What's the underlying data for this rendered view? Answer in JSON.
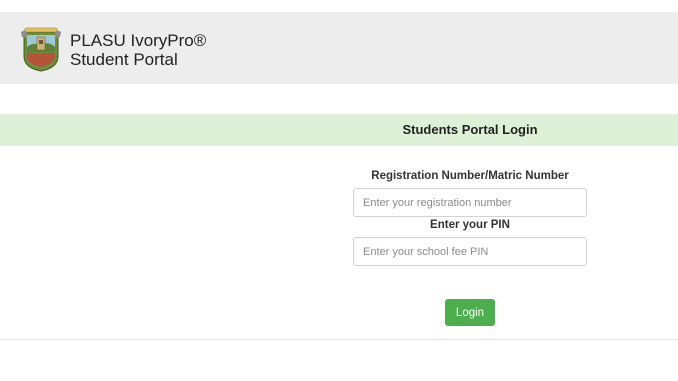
{
  "header": {
    "brand_line1": "PLASU IvoryPro®",
    "brand_line2": "Student Portal",
    "logo_icon": "university-crest-icon"
  },
  "login": {
    "title": "Students Portal Login",
    "registration_label": "Registration Number/Matric Number",
    "registration_placeholder": "Enter your registration number",
    "registration_value": "",
    "pin_label": "Enter your PIN",
    "pin_placeholder": "Enter your school fee PIN",
    "pin_value": "",
    "login_button": "Login"
  },
  "colors": {
    "header_bg": "#ededed",
    "banner_bg": "#dff0d8",
    "button_bg": "#4cae4c"
  }
}
